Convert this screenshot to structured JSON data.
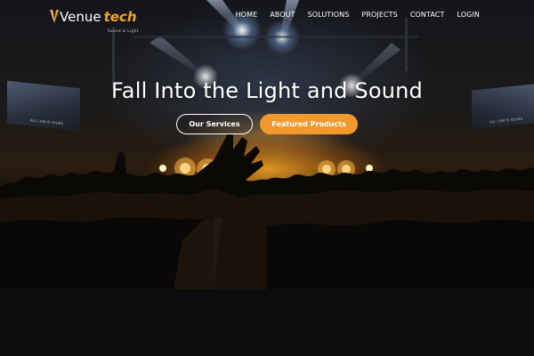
{
  "brand": {
    "name_part1": "Venue",
    "name_part2": "tech",
    "tagline": "Sound & Light",
    "logo_icon": "venue-v-logo-icon"
  },
  "nav": {
    "items": [
      {
        "label": "HOME"
      },
      {
        "label": "ABOUT"
      },
      {
        "label": "SOLUTIONS"
      },
      {
        "label": "PROJECTS"
      },
      {
        "label": "CONTACT"
      },
      {
        "label": "LOGIN"
      }
    ]
  },
  "hero": {
    "headline": "Fall Into the Light and Sound",
    "buttons": {
      "services_label": "Our Services",
      "products_label": "Featured Products"
    },
    "screen_left_text": "ALL I AM IS YOURS",
    "screen_right_text": "ALL I AM IS YOURS"
  },
  "colors": {
    "accent": "#f2992e",
    "text": "#ffffff",
    "footer_bg": "#0c0c0c"
  }
}
